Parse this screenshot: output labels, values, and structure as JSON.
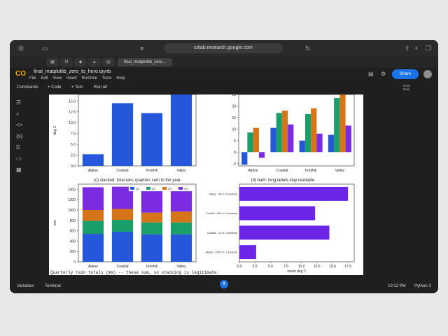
{
  "browser": {
    "url": "colab.research.google.com",
    "tab_active": "final_matplotlib_zero...",
    "tab_icons": [
      "grid-icon",
      "gmail-icon",
      "maps-icon",
      "drive-icon",
      "docs-icon"
    ]
  },
  "colab": {
    "notebook_title": "final_matplotlib_zero_to_hero.ipynb",
    "menu": [
      "File",
      "Edit",
      "View",
      "Insert",
      "Runtime",
      "Tools",
      "Help"
    ],
    "share_label": "Share",
    "toolbar": {
      "commands": "Commands",
      "code": "+ Code",
      "text": "+ Text",
      "run_all": "Run all"
    },
    "ram_label": "RAM",
    "disk_label": "Disk",
    "sidebar_icons": [
      "toc-icon",
      "search-icon",
      "code-icon",
      "variables-icon",
      "key-icon",
      "folder-icon",
      "table-icon"
    ],
    "bottom": {
      "variables": "Variables",
      "terminal": "Terminal",
      "time": "10:12 PM",
      "kernel": "Python 3"
    },
    "code_caption": "Quarterly rain totals (mm) -- these sum, so stacking is legitimate:"
  },
  "chart_data": [
    {
      "type": "bar",
      "title": "",
      "categories": [
        "Alpine",
        "Coastal",
        "Foothill",
        "Valley"
      ],
      "values": [
        2.7,
        14.5,
        12.2,
        17.5
      ],
      "ylabel": "deg C",
      "yticks": [
        "0.0",
        "2.5",
        "5.0",
        "7.5",
        "10.0",
        "12.5",
        "15.0"
      ],
      "ylim": [
        0,
        16.5
      ],
      "color": "#2457d9"
    },
    {
      "type": "bar",
      "title": "",
      "categories": [
        "Alpine",
        "Coastal",
        "Foothill",
        "Valley"
      ],
      "series": [
        {
          "color": "#2457d9",
          "values": [
            -5.5,
            10.5,
            5.0,
            7.5
          ]
        },
        {
          "color": "#1a9e6a",
          "values": [
            8.5,
            17.0,
            16.5,
            23.5
          ]
        },
        {
          "color": "#d6741a",
          "values": [
            10.5,
            18.0,
            19.0,
            26.5
          ]
        },
        {
          "color": "#7b2be0",
          "values": [
            -2.5,
            12.0,
            8.0,
            11.5
          ]
        }
      ],
      "yticks": [
        "-5",
        "0",
        "5",
        "10",
        "15",
        "20",
        "25"
      ],
      "ylim": [
        -6,
        25
      ]
    },
    {
      "type": "bar",
      "title": "(c) stacked: total rain, quarters sum to the year",
      "categories": [
        "Alpine",
        "Coastal",
        "Foothill",
        "Valley"
      ],
      "series": [
        {
          "name": "Q1",
          "color": "#2457d9",
          "values": [
            540,
            580,
            530,
            530
          ]
        },
        {
          "name": "Q2",
          "color": "#1a9e6a",
          "values": [
            250,
            230,
            230,
            230
          ]
        },
        {
          "name": "Q3",
          "color": "#d6741a",
          "values": [
            210,
            210,
            190,
            210
          ]
        },
        {
          "name": "Q4",
          "color": "#7b2be0",
          "values": [
            440,
            430,
            450,
            440
          ]
        }
      ],
      "ylabel": "mm",
      "yticks": [
        "0",
        "200",
        "400",
        "600",
        "800",
        "1000",
        "1200",
        "1400"
      ],
      "ylim": [
        0,
        1500
      ]
    },
    {
      "type": "bar",
      "orientation": "horizontal",
      "title": "(d) barh: long labels stay readable",
      "categories": [
        "Valley - 95 m, 5 sensors",
        "Foothill - 640 m, 2 sensors",
        "Coastal - 12 m, 3 sensors",
        "Alpine - 2310 m, 2 sensors"
      ],
      "values": [
        17.5,
        12.2,
        14.5,
        2.7
      ],
      "xlabel": "mean deg C",
      "xticks": [
        "0.0",
        "2.5",
        "5.0",
        "7.5",
        "10.0",
        "12.5",
        "15.0",
        "17.5"
      ],
      "xlim": [
        0,
        18.5
      ],
      "color": "#6c24e6"
    }
  ]
}
